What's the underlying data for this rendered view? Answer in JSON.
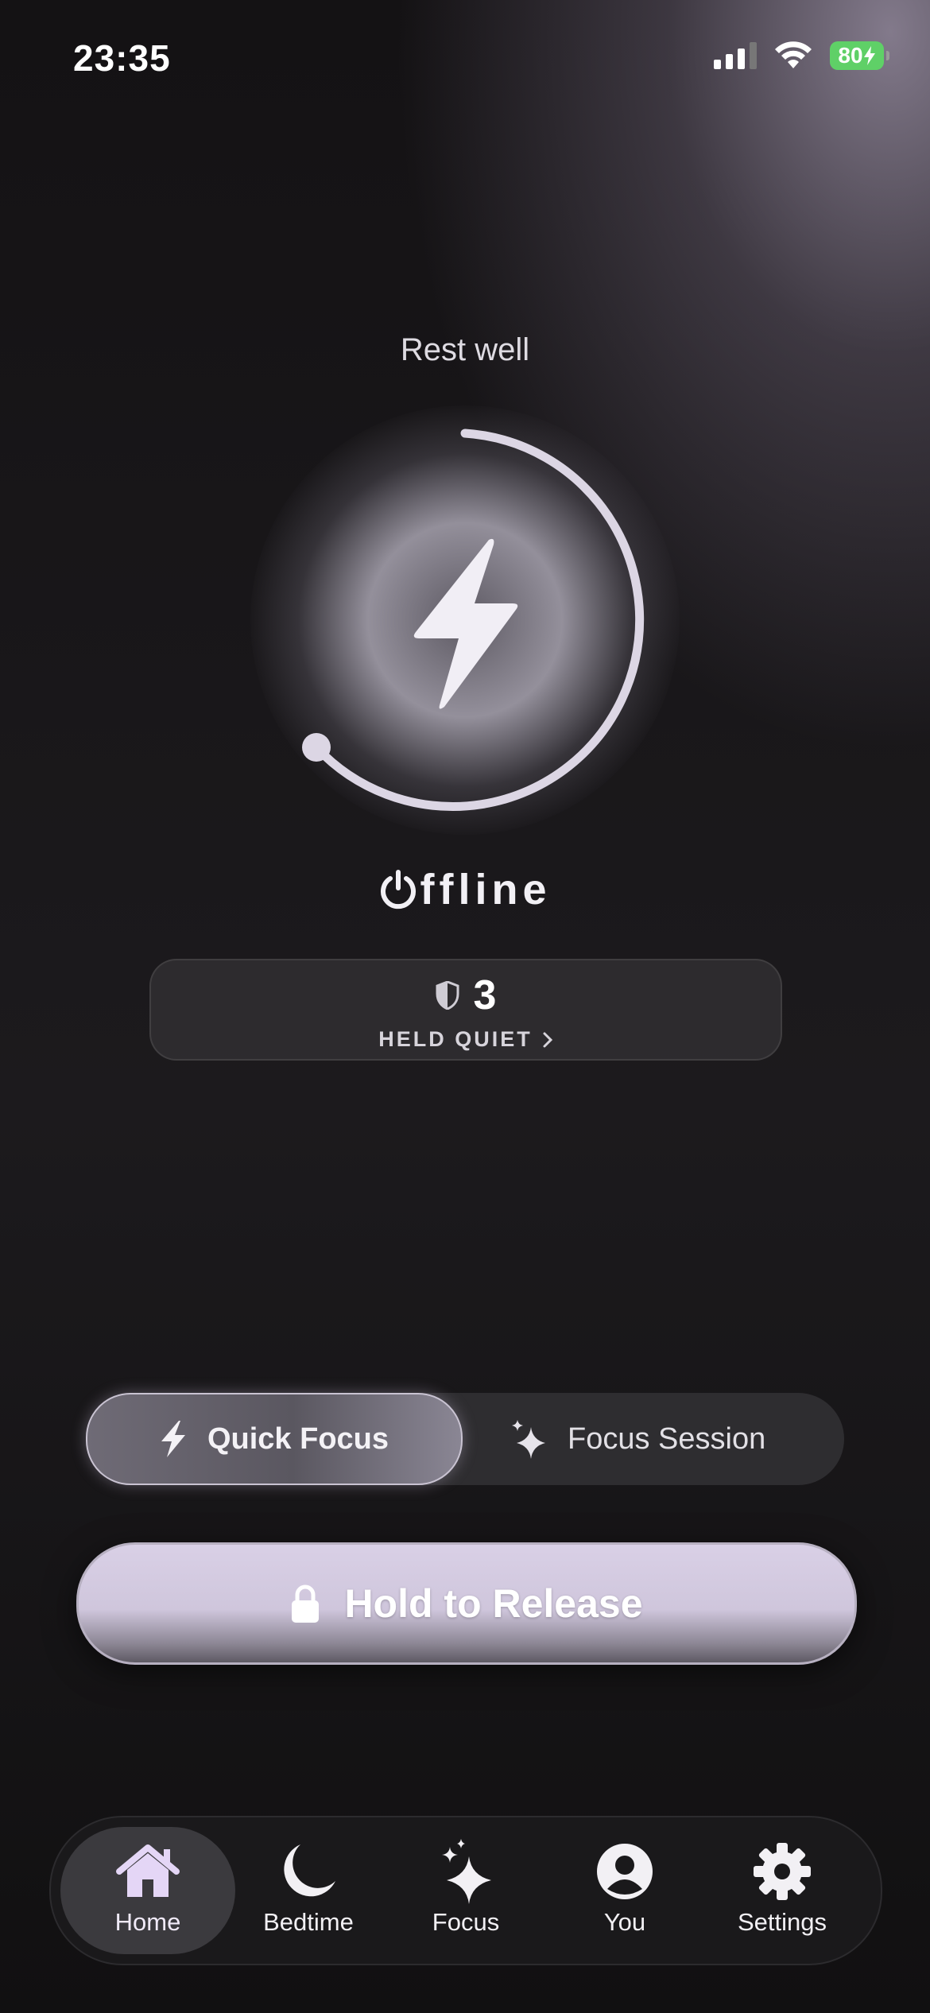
{
  "status_bar": {
    "time": "23:35",
    "battery_level": "80"
  },
  "home": {
    "greeting": "Rest well",
    "status_label": "ffline",
    "held": {
      "count": "3",
      "label": "HELD QUIET"
    }
  },
  "mode_selector": {
    "active": "Quick Focus",
    "options": [
      {
        "label": "Quick Focus",
        "icon": "bolt-icon"
      },
      {
        "label": "Focus Session",
        "icon": "sparkles-icon"
      }
    ]
  },
  "release_button": {
    "label": "Hold to Release",
    "icon": "lock-icon"
  },
  "tab_bar": {
    "active": "Home",
    "items": [
      {
        "label": "Home",
        "icon": "home-icon"
      },
      {
        "label": "Bedtime",
        "icon": "moon-icon"
      },
      {
        "label": "Focus",
        "icon": "sparkles-icon"
      },
      {
        "label": "You",
        "icon": "person-icon"
      },
      {
        "label": "Settings",
        "icon": "gear-icon"
      }
    ]
  },
  "colors": {
    "accent": "#d9d0e6",
    "battery": "#5fd067",
    "background": "#111011"
  }
}
